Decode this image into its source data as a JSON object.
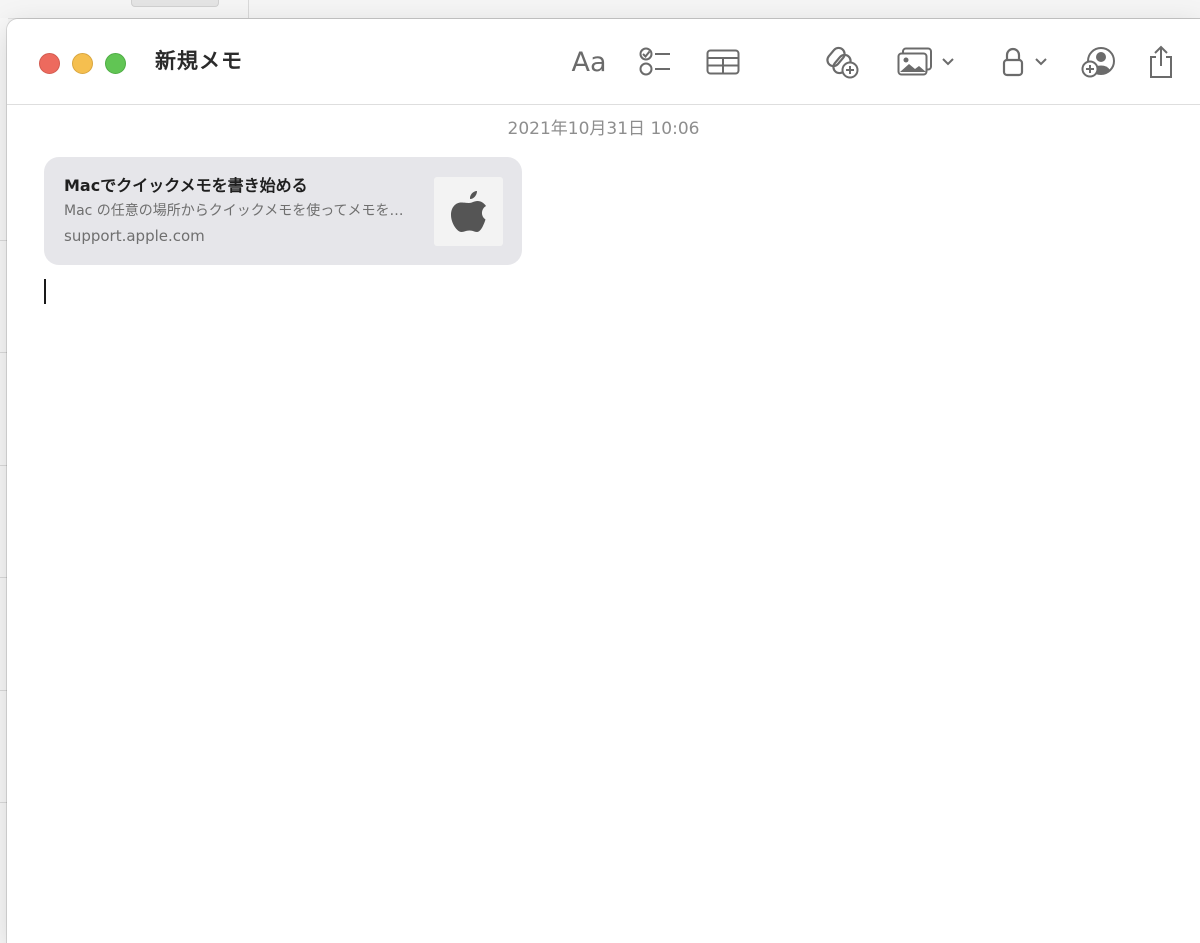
{
  "window": {
    "title": "新規メモ"
  },
  "toolbar": {
    "format_label": "Aa",
    "icons": [
      "text-format-icon",
      "checklist-icon",
      "table-icon",
      "add-link-icon",
      "media-icon",
      "lock-icon",
      "collaborate-icon",
      "share-icon"
    ]
  },
  "note": {
    "date": "2021年10月31日 10:06",
    "link_card": {
      "title": "Macでクイックメモを書き始める",
      "description": "Mac の任意の場所からクイックメモを使ってメモを…",
      "domain": "support.apple.com",
      "thumbnail_icon": "apple-logo-icon"
    }
  },
  "colors": {
    "close": "#ed6a5e",
    "minimize": "#f5bf4f",
    "maximize": "#61c554",
    "card_background": "#e6e6ea"
  }
}
